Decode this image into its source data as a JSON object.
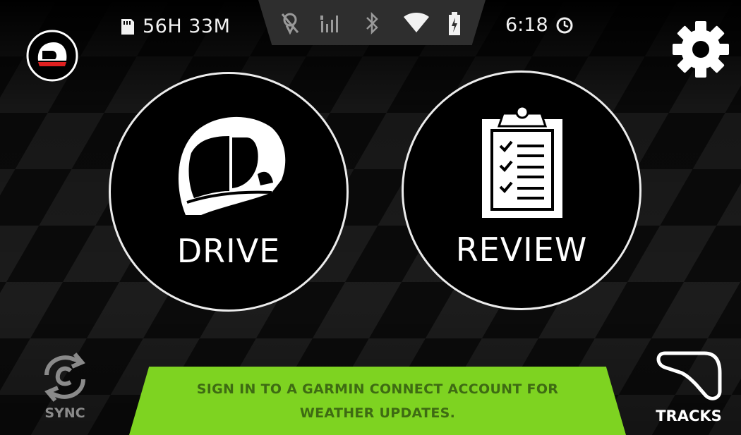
{
  "status_bar": {
    "storage_icon": "sd-card-icon",
    "storage_remaining": "56H 33M",
    "icons": [
      "no-gps-icon",
      "cell-signal-icon",
      "bluetooth-icon",
      "wifi-icon",
      "battery-charging-icon"
    ],
    "time": "6:18",
    "time_icon": "clock-icon"
  },
  "header": {
    "profile_icon": "helmet-profile-icon",
    "settings_icon": "gear-icon"
  },
  "main": {
    "drive": {
      "label": "DRIVE",
      "icon": "helmet-icon"
    },
    "review": {
      "label": "REVIEW",
      "icon": "clipboard-checklist-icon"
    }
  },
  "footer": {
    "sync": {
      "label": "SYNC",
      "icon": "sync-icon"
    },
    "banner": {
      "line1": "SIGN IN TO A GARMIN CONNECT ACCOUNT FOR",
      "line2": "WEATHER UPDATES."
    },
    "tracks": {
      "label": "TRACKS",
      "icon": "track-outline-icon"
    }
  },
  "colors": {
    "background": "#000000",
    "banner_green": "#7ed321",
    "banner_text": "#3e6b13",
    "accent_red": "#e02020"
  }
}
